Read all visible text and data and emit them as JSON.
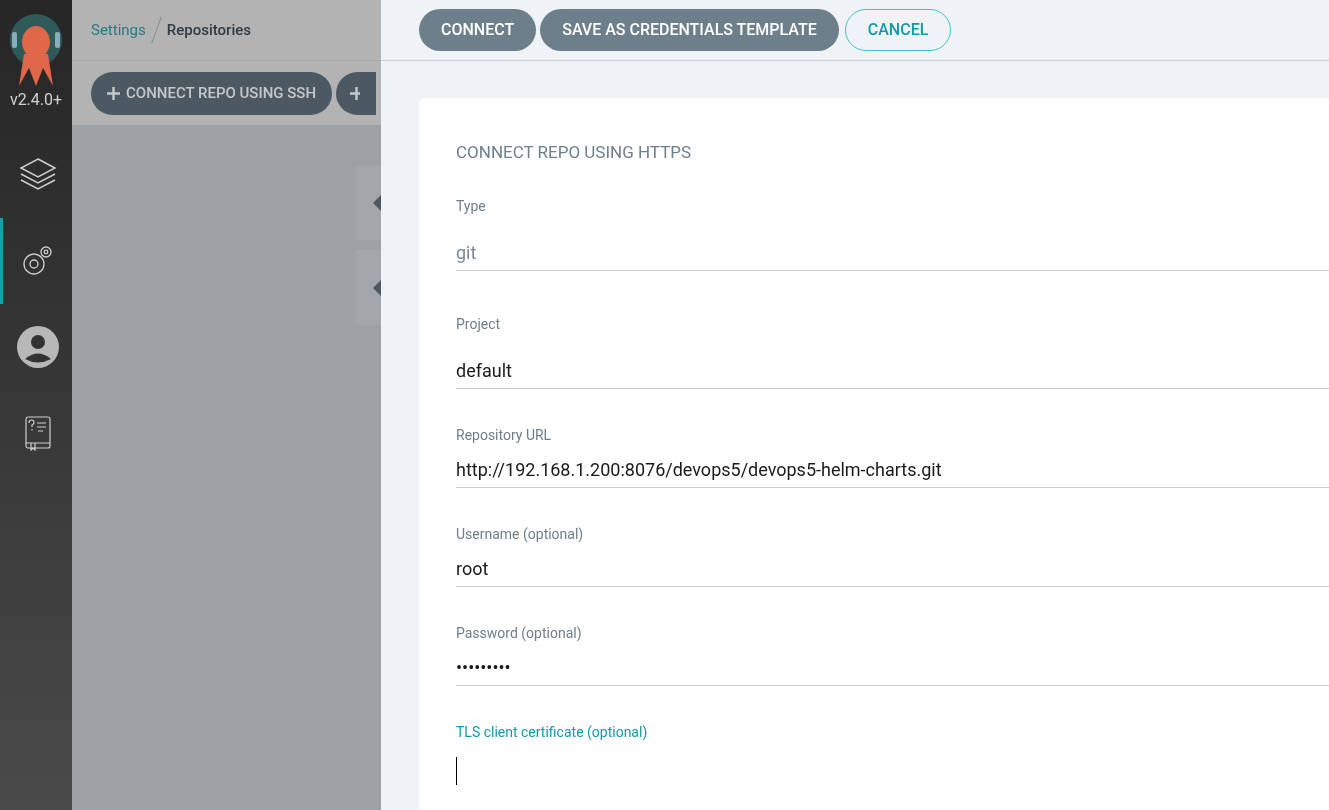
{
  "sidebar": {
    "version": "v2.4.0+",
    "nav_items": [
      {
        "kind": "layers",
        "selected": false
      },
      {
        "kind": "settings",
        "selected": true
      },
      {
        "kind": "user",
        "selected": false
      },
      {
        "kind": "docs",
        "selected": false
      }
    ]
  },
  "breadcrumb": [
    {
      "label": "Settings",
      "kind": "link"
    },
    {
      "label": "Repositories",
      "kind": "current"
    }
  ],
  "toolbar": {
    "buttons": [
      {
        "label": "CONNECT REPO USING SSH"
      }
    ]
  },
  "panel": {
    "actions": [
      {
        "label": "CONNECT",
        "kind": "filled"
      },
      {
        "label": "SAVE AS CREDENTIALS TEMPLATE",
        "kind": "filled"
      },
      {
        "label": "CANCEL",
        "kind": "outline"
      }
    ],
    "title": "CONNECT REPO USING HTTPS",
    "fields": [
      {
        "label": "Type",
        "value": "git",
        "kind": "select",
        "focused": false
      },
      {
        "label": "Project",
        "value": "default",
        "kind": "text",
        "focused": false
      },
      {
        "label": "Repository URL",
        "value": "http://192.168.1.200:8076/devops5/devops5-helm-charts.git",
        "kind": "text",
        "focused": false
      },
      {
        "label": "Username (optional)",
        "value": "root",
        "kind": "text",
        "focused": false
      },
      {
        "label": "Password (optional)",
        "value": "•••••••••",
        "kind": "password",
        "focused": false
      },
      {
        "label": "TLS client certificate (optional)",
        "kind": "textarea",
        "focused": true
      }
    ]
  }
}
